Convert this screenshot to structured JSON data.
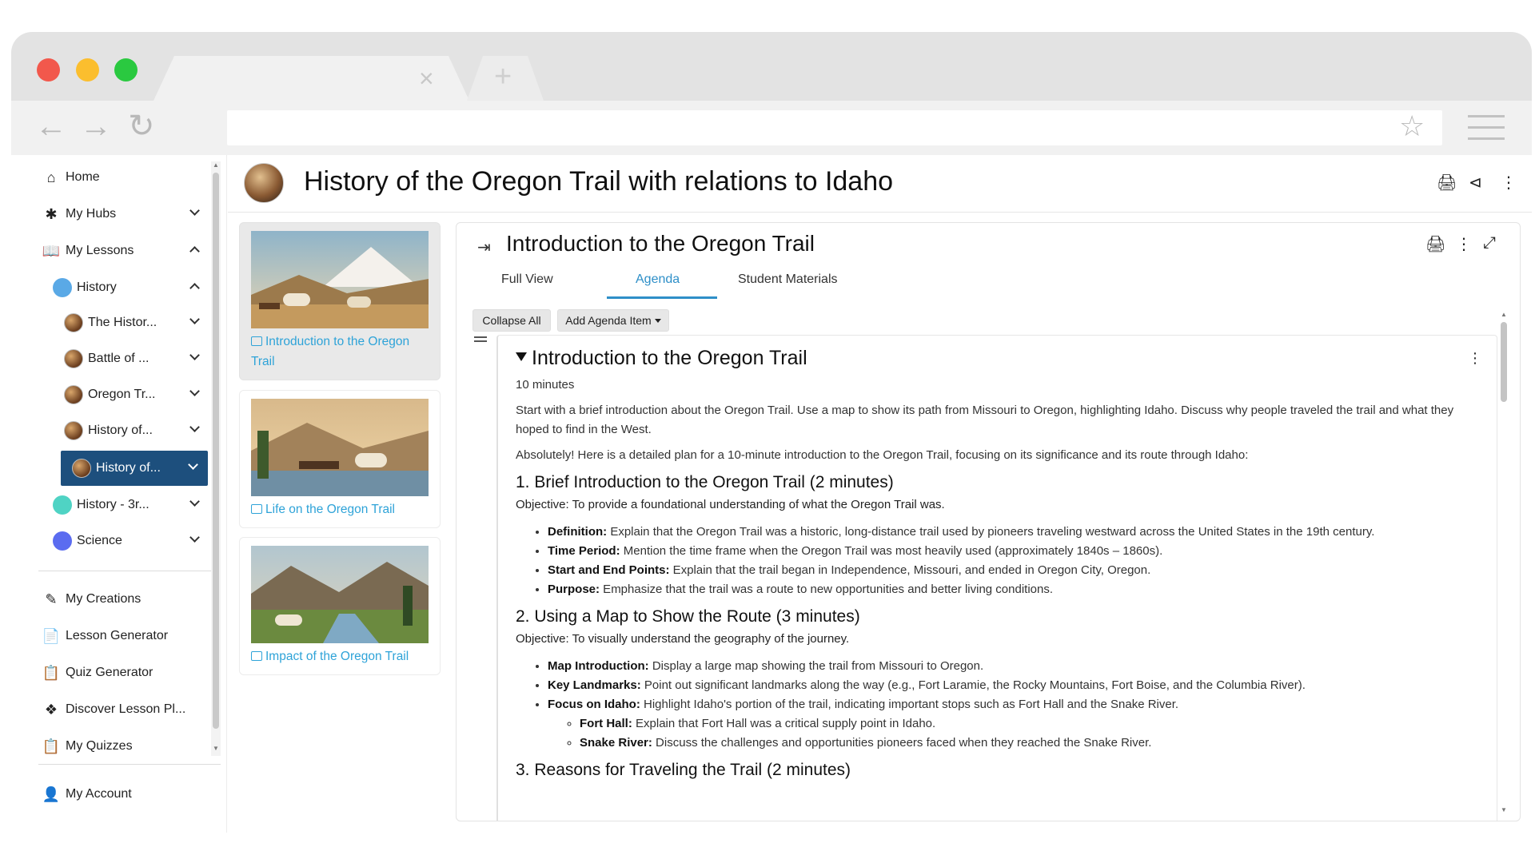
{
  "browser": {
    "new_tab": "+",
    "close_tab": "×"
  },
  "sidebar": {
    "home": "Home",
    "my_hubs": "My Hubs",
    "my_lessons": "My Lessons",
    "history": "History",
    "lessons": [
      "The Histor...",
      "Battle of ...",
      "Oregon Tr...",
      "History of...",
      "History of..."
    ],
    "history_3r": "History - 3r...",
    "science": "Science",
    "my_creations": "My Creations",
    "lesson_generator": "Lesson Generator",
    "quiz_generator": "Quiz Generator",
    "discover": "Discover Lesson Pl...",
    "my_quizzes": "My Quizzes",
    "my_account": "My Account"
  },
  "header": {
    "title": "History of the Oregon Trail with relations to Idaho"
  },
  "cards": [
    {
      "label": "Introduction to the Oregon Trail"
    },
    {
      "label": "Life on the Oregon Trail"
    },
    {
      "label": "Impact of the Oregon Trail"
    }
  ],
  "panel": {
    "title": "Introduction to the Oregon Trail",
    "tabs": [
      "Full View",
      "Agenda",
      "Student Materials"
    ],
    "collapse_all": "Collapse All",
    "add_agenda_item": "Add Agenda Item"
  },
  "agenda_item": {
    "title": "Introduction to the Oregon Trail",
    "duration": "10 minutes",
    "intro": "Start with a brief introduction about the Oregon Trail. Use a map to show its path from Missouri to Oregon, highlighting Idaho. Discuss why people traveled the trail and what they hoped to find in the West.",
    "plan_intro": "Absolutely! Here is a detailed plan for a 10-minute introduction to the Oregon Trail, focusing on its significance and its route through Idaho:",
    "section1": {
      "heading": "1. Brief Introduction to the Oregon Trail (2 minutes)",
      "objective": "Objective: To provide a foundational understanding of what the Oregon Trail was.",
      "bullets": [
        {
          "term": "Definition:",
          "text": " Explain that the Oregon Trail was a historic, long-distance trail used by pioneers traveling westward across the United States in the 19th century."
        },
        {
          "term": "Time Period:",
          "text": " Mention the time frame when the Oregon Trail was most heavily used (approximately 1840s – 1860s)."
        },
        {
          "term": "Start and End Points:",
          "text": " Explain that the trail began in Independence, Missouri, and ended in Oregon City, Oregon."
        },
        {
          "term": "Purpose:",
          "text": " Emphasize that the trail was a route to new opportunities and better living conditions."
        }
      ]
    },
    "section2": {
      "heading": "2. Using a Map to Show the Route (3 minutes)",
      "objective": "Objective: To visually understand the geography of the journey.",
      "bullets": [
        {
          "term": "Map Introduction:",
          "text": " Display a large map showing the trail from Missouri to Oregon."
        },
        {
          "term": "Key Landmarks:",
          "text": " Point out significant landmarks along the way (e.g., Fort Laramie, the Rocky Mountains, Fort Boise, and the Columbia River)."
        },
        {
          "term": "Focus on Idaho:",
          "text": " Highlight Idaho's portion of the trail, indicating important stops such as Fort Hall and the Snake River."
        }
      ],
      "sub_bullets": [
        {
          "term": "Fort Hall:",
          "text": " Explain that Fort Hall was a critical supply point in Idaho."
        },
        {
          "term": "Snake River:",
          "text": " Discuss the challenges and opportunities pioneers faced when they reached the Snake River."
        }
      ]
    },
    "section3": {
      "heading": "3. Reasons for Traveling the Trail (2 minutes)"
    }
  },
  "colors": {
    "accent": "#2e8fc8",
    "active_nav": "#1d4f7d",
    "link": "#2ea3d8"
  }
}
